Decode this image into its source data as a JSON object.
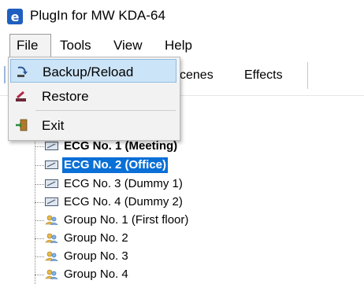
{
  "window": {
    "title": "PlugIn for MW KDA-64",
    "icon": "app-e-icon"
  },
  "menubar": {
    "file": "File",
    "tools": "Tools",
    "view": "View",
    "help": "Help"
  },
  "tabs": {
    "scenes": "cenes",
    "effects": "Effects"
  },
  "file_menu": {
    "backup": {
      "label": "Backup/Reload",
      "icon": "backup-icon",
      "highlighted": true
    },
    "restore": {
      "label": "Restore",
      "icon": "restore-icon"
    },
    "exit": {
      "label": "Exit",
      "icon": "exit-icon"
    }
  },
  "tree": {
    "items": [
      {
        "label": "ECG No. 1 (Meeting)",
        "icon": "ecg-device-icon",
        "bold": true
      },
      {
        "label": "ECG No. 2 (Office)",
        "icon": "ecg-device-icon",
        "bold": true,
        "selected": true
      },
      {
        "label": "ECG No. 3 (Dummy 1)",
        "icon": "ecg-device-icon"
      },
      {
        "label": "ECG No. 4 (Dummy 2)",
        "icon": "ecg-device-icon"
      },
      {
        "label": "Group No. 1 (First floor)",
        "icon": "group-icon"
      },
      {
        "label": "Group No. 2",
        "icon": "group-icon"
      },
      {
        "label": "Group No. 3",
        "icon": "group-icon"
      },
      {
        "label": "Group No. 4",
        "icon": "group-icon"
      }
    ]
  },
  "colors": {
    "selection": "#0a6fd6",
    "menu_highlight": "#cce4f7",
    "app_icon": "#1f5fbf"
  }
}
